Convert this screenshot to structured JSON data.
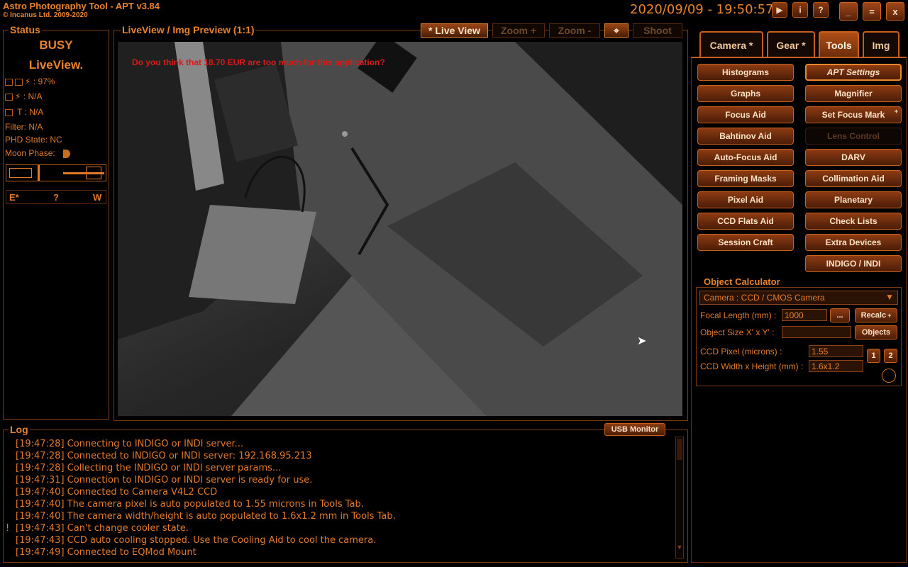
{
  "app": {
    "title": "Astro Photography Tool  -  APT v3.84",
    "copyright": "© Incanus Ltd. 2009-2020",
    "datetime": "2020/09/09 - 19:50:57"
  },
  "top_buttons": {
    "play": "▶",
    "info": "i",
    "help": "?",
    "minimize": "_",
    "maximize": "=",
    "close": "x"
  },
  "status": {
    "title": "Status",
    "state": "BUSY",
    "mode": "LiveView.",
    "battery": ": 97%",
    "power": ": N/A",
    "temp_label": "T :",
    "temp": "N/A",
    "filter": "Filter: N/A",
    "phd": "PHD State: NC",
    "moon": "Moon Phase:",
    "compass": {
      "e": "E*",
      "q": "?",
      "w": "W"
    }
  },
  "preview": {
    "title": "LiveView / Img Preview (1:1)",
    "nag": "Do you think that 18.70 EUR are too much for this application?"
  },
  "toolbar": {
    "live_view": "* Live View",
    "zoom_in": "Zoom +",
    "zoom_out": "Zoom -",
    "shoot": "Shoot"
  },
  "tabs": [
    "Camera *",
    "Gear *",
    "Tools",
    "Img"
  ],
  "tools": {
    "left": [
      "Histograms",
      "Graphs",
      "Focus Aid",
      "Bahtinov Aid",
      "Auto-Focus Aid",
      "Framing Masks",
      "Pixel Aid",
      "CCD Flats Aid",
      "Session Craft"
    ],
    "right": [
      "APT Settings",
      "Magnifier",
      "Set Focus Mark",
      "Lens Control",
      "DARV",
      "Collimation Aid",
      "Planetary",
      "Check Lists",
      "Extra Devices",
      "INDIGO / INDI"
    ],
    "plus": "+"
  },
  "object_calc": {
    "title": "Object Calculator",
    "camera": "Camera : CCD / CMOS Camera",
    "focal_label": "Focal Length (mm) :",
    "focal_value": "1000",
    "dots": "...",
    "recalc": "Recalc",
    "object_size_label": "Object Size X' x Y' :",
    "object_size_value": "",
    "objects": "Objects",
    "pixel_label": "CCD Pixel (microns) :",
    "pixel_value": "1.55",
    "btn1": "1",
    "btn2": "2",
    "wh_label": "CCD Width x Height (mm) :",
    "wh_value": "1.6x1.2"
  },
  "log": {
    "title": "Log",
    "usb_monitor": "USB Monitor",
    "lines": [
      {
        "mark": "",
        "text": "[19:47:28] Connecting to INDIGO or INDI server..."
      },
      {
        "mark": "",
        "text": "[19:47:28] Connected to INDIGO or INDI server: 192.168.95.213"
      },
      {
        "mark": "",
        "text": "[19:47:28] Collecting the INDIGO or INDI server params..."
      },
      {
        "mark": "",
        "text": "[19:47:31] Connection to INDIGO or INDI server is ready for use."
      },
      {
        "mark": "",
        "text": "[19:47:40] Connected to Camera V4L2 CCD"
      },
      {
        "mark": "",
        "text": "[19:47:40] The camera pixel is auto populated to 1.55 microns in Tools Tab."
      },
      {
        "mark": "",
        "text": "[19:47:40] The camera width/height is auto populated to 1.6x1.2 mm in Tools Tab."
      },
      {
        "mark": "!",
        "text": "[19:47:43] Can't change cooler state."
      },
      {
        "mark": "",
        "text": "[19:47:43] CCD auto cooling stopped. Use the Cooling Aid to cool the camera."
      },
      {
        "mark": "",
        "text": "[19:47:49] Connected to EQMod Mount"
      }
    ]
  }
}
